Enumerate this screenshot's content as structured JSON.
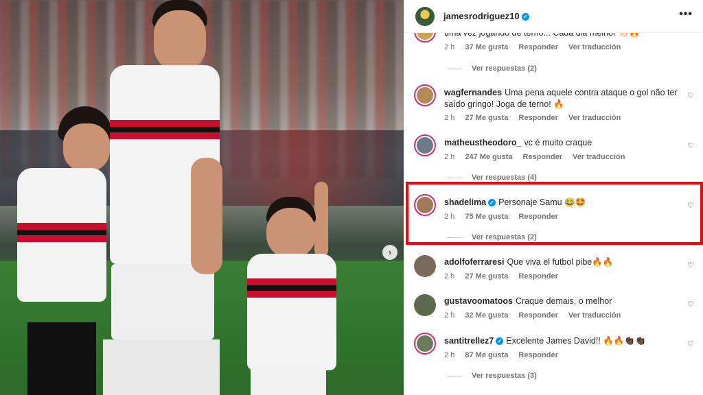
{
  "photo": {
    "next_label": "›"
  },
  "header": {
    "username": "jamesrodriguez10",
    "more_label": "•••"
  },
  "comments": [
    {
      "user": "",
      "text": "uma vez jogando de terno... Cada dia melhor 👏🏻🔥",
      "time": "2 h",
      "likes": "37 Me gusta",
      "reply": "Responder",
      "translate": "Ver traducción",
      "replies": "Ver respuestas (2)"
    },
    {
      "user": "wagfernandes",
      "text": "Uma pena aquele contra ataque o gol não ter saído gringo! Joga de terno! 🔥",
      "time": "2 h",
      "likes": "27 Me gusta",
      "reply": "Responder",
      "translate": "Ver traducción"
    },
    {
      "user": "matheustheodoro_",
      "text": "vc é muito craque",
      "time": "2 h",
      "likes": "247 Me gusta",
      "reply": "Responder",
      "translate": "Ver traducción",
      "replies": "Ver respuestas (4)"
    },
    {
      "user": "shadelima",
      "text": "Personaje Samu 😂🤩",
      "time": "2 h",
      "likes": "75 Me gusta",
      "reply": "Responder",
      "replies": "Ver respuestas (2)"
    },
    {
      "user": "adolfoferraresi",
      "text": "Que viva el futbol pibe🔥🔥",
      "time": "2 h",
      "likes": "27 Me gusta",
      "reply": "Responder"
    },
    {
      "user": "gustavoomatoos",
      "text": "Craque demais, o melhor",
      "time": "2 h",
      "likes": "32 Me gusta",
      "reply": "Responder",
      "translate": "Ver traducción"
    },
    {
      "user": "santitrellez7",
      "text": "Excelente James David!! 🔥🔥👏🏿👏🏿",
      "time": "2 h",
      "likes": "87 Me gusta",
      "reply": "Responder",
      "replies": "Ver respuestas (3)"
    }
  ],
  "colors": {
    "highlight": "#ff0000",
    "verified": "#0095f6",
    "story_ring": "#d62976"
  }
}
